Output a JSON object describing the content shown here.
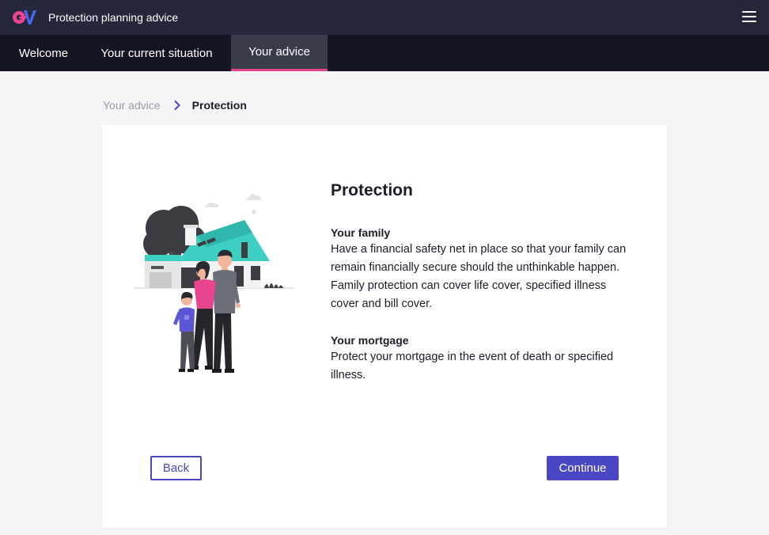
{
  "header": {
    "app_title": "Protection planning advice",
    "logo_icon": "ev-logo",
    "menu_icon": "hamburger-menu-icon"
  },
  "nav": {
    "tabs": [
      {
        "label": "Welcome",
        "active": false
      },
      {
        "label": "Your current situation",
        "active": false
      },
      {
        "label": "Your advice",
        "active": true
      }
    ]
  },
  "breadcrumb": {
    "parent": "Your advice",
    "separator_icon": "chevron-right-icon",
    "current": "Protection"
  },
  "main": {
    "heading": "Protection",
    "illustration": "family-house-illustration",
    "sections": [
      {
        "title": "Your family",
        "body": "Have a financial safety net in place so that your family can remain financially secure should the unthinkable happen. Family protection can cover life cover, specified illness cover and bill cover."
      },
      {
        "title": "Your mortgage",
        "body": "Protect your mortgage in the event of death or specified illness."
      }
    ]
  },
  "actions": {
    "back_label": "Back",
    "continue_label": "Continue"
  },
  "colors": {
    "header_bg": "#25273a",
    "nav_bg": "#151623",
    "active_tab_bg": "#3a3c4c",
    "accent_pink": "#e9458f",
    "primary_button": "#4a47c5",
    "illustration_teal": "#3ecfc3"
  }
}
